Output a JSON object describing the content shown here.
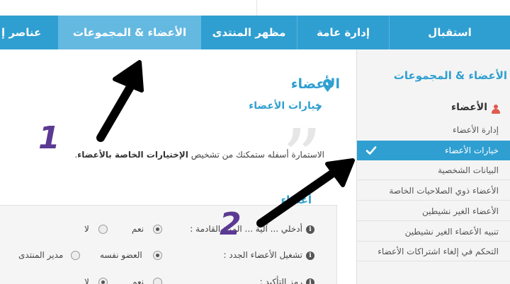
{
  "navbar": {
    "items": [
      {
        "label": "استقبال"
      },
      {
        "label": "إدارة عامة"
      },
      {
        "label": "مظهر المنتدى"
      },
      {
        "label": "الأعضاء & المجموعات"
      },
      {
        "label": "عناصر إ"
      }
    ]
  },
  "sidebar": {
    "title": "الأعضاء & المجموعات",
    "section": "الأعضاء",
    "items": [
      {
        "label": "إدارة الأعضاء"
      },
      {
        "label": "خيارات الأعضاء"
      },
      {
        "label": "البيانات الشخصية"
      },
      {
        "label": "الأعضاء ذوي الصلاحيات الخاصة"
      },
      {
        "label": "الأعضاء الغير نشيطين"
      },
      {
        "label": "تنبيه الأعضاء الغير نشيطين"
      },
      {
        "label": "التحكم في إلغاء اشتراكات الأعضاء"
      }
    ]
  },
  "main": {
    "title": "الأعضاء",
    "subtitle": "خيارات الأعضاء",
    "description_start": "الاستمارة أسفله ستمكنك من تشخيص",
    "description_bold": "الإختيارات الخاصة بالأعضاء",
    "description_end": "."
  },
  "panel": {
    "heading": "أعضاء",
    "options": [
      {
        "label": "أدخلي ... آلية ... المرة القادمة :",
        "choices": [
          "نعم",
          "لا"
        ],
        "selected": 0
      },
      {
        "label": "تشغيل الأعضاء الجدد :",
        "choices": [
          "العضو نفسه",
          "مدير المنتدى"
        ],
        "selected": 0
      },
      {
        "label": "رمز التأكيد :",
        "choices": [
          "نعم",
          "لا"
        ],
        "selected": 1
      }
    ]
  },
  "annotations": {
    "one": "1",
    "two": "2"
  },
  "colors": {
    "accent": "#2f9fd1",
    "active_tab": "#64b9e1",
    "annotation": "#5b3a93"
  },
  "icons": [
    "map-pin-icon",
    "chevron-right-icon",
    "user-icon",
    "check-icon",
    "info-icon"
  ]
}
